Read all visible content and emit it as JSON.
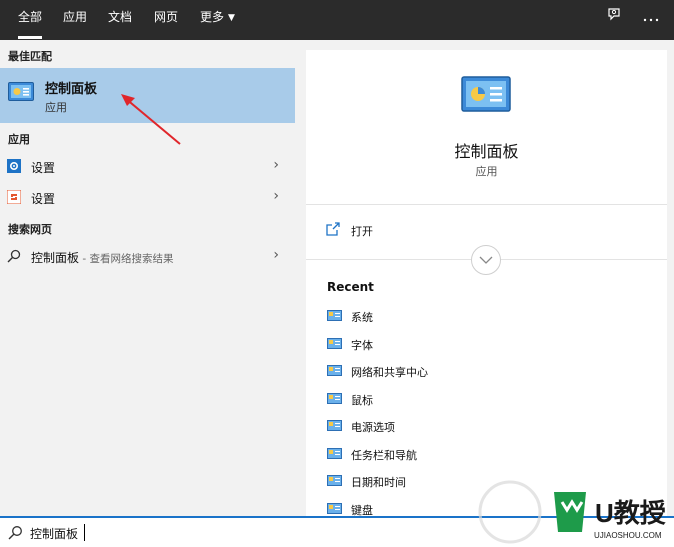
{
  "topbar": {
    "tabs": [
      {
        "label": "全部",
        "active": true
      },
      {
        "label": "应用",
        "active": false
      },
      {
        "label": "文档",
        "active": false
      },
      {
        "label": "网页",
        "active": false
      },
      {
        "label": "更多",
        "active": false,
        "has_dropdown": true
      }
    ],
    "icons": [
      "feedback-icon",
      "more-options-icon"
    ]
  },
  "left": {
    "best_match_header": "最佳匹配",
    "best_match": {
      "title": "控制面板",
      "subtitle": "应用",
      "icon": "control-panel-icon"
    },
    "apps_header": "应用",
    "apps": [
      {
        "label": "设置",
        "icon": "settings-blue-icon"
      },
      {
        "label": "设置",
        "icon": "settings-orange-icon"
      }
    ],
    "web_header": "搜索网页",
    "web_result": {
      "label": "控制面板",
      "suffix": " - 查看网络搜索结果"
    }
  },
  "preview": {
    "title": "控制面板",
    "subtitle": "应用",
    "open_label": "打开",
    "recent_title": "Recent",
    "recent_items": [
      "系统",
      "字体",
      "网络和共享中心",
      "鼠标",
      "电源选项",
      "任务栏和导航",
      "日期和时间",
      "键盘"
    ]
  },
  "search": {
    "value": "控制面板"
  },
  "watermark": {
    "text": "U教授",
    "url": "UJIAOSHOU.COM"
  },
  "colors": {
    "accent": "#1a73c9",
    "highlight": "#a8cbe9",
    "topbar": "#2b2b2b",
    "arrow": "#e0262b"
  }
}
